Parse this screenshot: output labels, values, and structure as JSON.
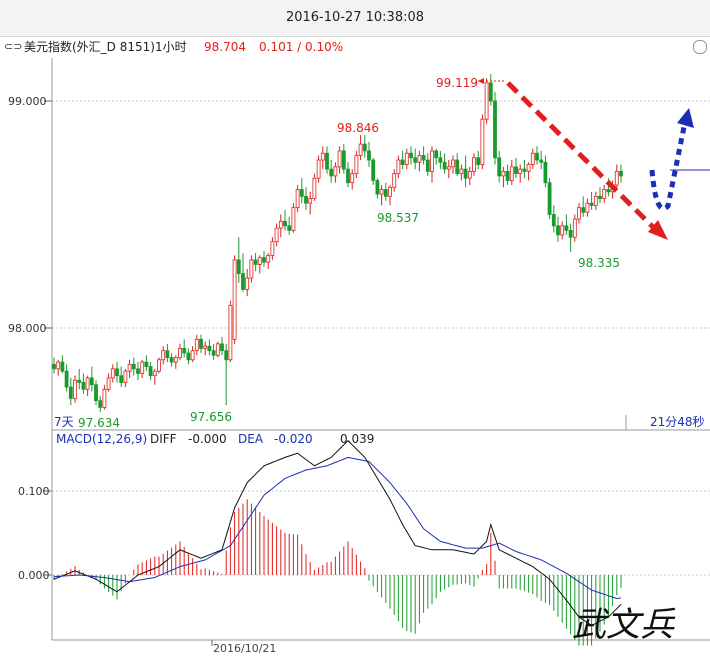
{
  "window": {
    "timestamp": "2016-10-27 10:38:08"
  },
  "instrument": {
    "link_icon": "⊂⊃",
    "name": "美元指数(外汇_D 8151)1小时",
    "price": "98.704",
    "change": "0.101 / 0.10%"
  },
  "colors": {
    "up": "#e0201c",
    "down": "#1a9a2e",
    "diff_line": "#111111",
    "dea_line": "#1b2fb5",
    "grid": "#c8c8c8",
    "trend_arrow": "#e0201c",
    "forecast_arrow": "#1b2fb5"
  },
  "chart_data": [
    {
      "type": "candlestick",
      "interval": "1小时",
      "y_tick_labels": [
        "99.000",
        "98.000"
      ],
      "ylim": [
        97.56,
        99.25
      ],
      "period_label": "7天",
      "countdown": "21分48秒",
      "annotations": [
        {
          "label": "99.119",
          "value": 99.119,
          "kind": "high"
        },
        {
          "label": "98.846",
          "value": 98.846,
          "kind": "high"
        },
        {
          "label": "98.537",
          "value": 98.537,
          "kind": "low"
        },
        {
          "label": "98.335",
          "value": 98.335,
          "kind": "low"
        },
        {
          "label": "97.634",
          "value": 97.634,
          "kind": "low"
        },
        {
          "label": "97.656",
          "value": 97.656,
          "kind": "low"
        }
      ],
      "ohlc": [
        [
          97.84,
          97.87,
          97.8,
          97.82
        ],
        [
          97.82,
          97.86,
          97.79,
          97.85
        ],
        [
          97.85,
          97.88,
          97.8,
          97.81
        ],
        [
          97.81,
          97.84,
          97.72,
          97.74
        ],
        [
          97.74,
          97.78,
          97.66,
          97.69
        ],
        [
          97.69,
          97.79,
          97.67,
          97.77
        ],
        [
          97.77,
          97.82,
          97.73,
          97.76
        ],
        [
          97.76,
          97.8,
          97.71,
          97.73
        ],
        [
          97.73,
          97.79,
          97.7,
          97.78
        ],
        [
          97.78,
          97.83,
          97.72,
          97.75
        ],
        [
          97.75,
          97.77,
          97.66,
          97.68
        ],
        [
          97.68,
          97.7,
          97.63,
          97.65
        ],
        [
          97.65,
          97.75,
          97.64,
          97.73
        ],
        [
          97.73,
          97.8,
          97.72,
          97.78
        ],
        [
          97.78,
          97.84,
          97.76,
          97.82
        ],
        [
          97.82,
          97.85,
          97.76,
          97.79
        ],
        [
          97.79,
          97.83,
          97.74,
          97.76
        ],
        [
          97.76,
          97.82,
          97.74,
          97.81
        ],
        [
          97.81,
          97.86,
          97.78,
          97.84
        ],
        [
          97.84,
          97.87,
          97.79,
          97.82
        ],
        [
          97.82,
          97.85,
          97.77,
          97.8
        ],
        [
          97.8,
          97.86,
          97.78,
          97.85
        ],
        [
          97.85,
          97.88,
          97.81,
          97.83
        ],
        [
          97.83,
          97.85,
          97.77,
          97.79
        ],
        [
          97.79,
          97.82,
          97.75,
          97.81
        ],
        [
          97.81,
          97.87,
          97.8,
          97.86
        ],
        [
          97.86,
          97.92,
          97.84,
          97.9
        ],
        [
          97.9,
          97.93,
          97.85,
          97.87
        ],
        [
          97.87,
          97.89,
          97.83,
          97.85
        ],
        [
          97.85,
          97.88,
          97.82,
          97.87
        ],
        [
          97.87,
          97.93,
          97.86,
          97.91
        ],
        [
          97.91,
          97.95,
          97.87,
          97.89
        ],
        [
          97.89,
          97.91,
          97.84,
          97.86
        ],
        [
          97.86,
          97.92,
          97.85,
          97.9
        ],
        [
          97.9,
          97.97,
          97.88,
          97.95
        ],
        [
          97.95,
          97.97,
          97.89,
          97.91
        ],
        [
          97.91,
          97.94,
          97.88,
          97.92
        ],
        [
          97.92,
          97.95,
          97.88,
          97.9
        ],
        [
          97.9,
          97.93,
          97.86,
          97.88
        ],
        [
          97.88,
          97.94,
          97.87,
          97.93
        ],
        [
          97.93,
          97.96,
          97.88,
          97.9
        ],
        [
          97.9,
          97.93,
          97.66,
          97.86
        ],
        [
          97.86,
          98.12,
          97.85,
          98.1
        ],
        [
          97.95,
          98.32,
          97.93,
          98.3
        ],
        [
          98.3,
          98.4,
          98.2,
          98.24
        ],
        [
          98.24,
          98.33,
          98.16,
          98.17
        ],
        [
          98.17,
          98.26,
          98.14,
          98.22
        ],
        [
          98.22,
          98.32,
          98.2,
          98.3
        ],
        [
          98.3,
          98.33,
          98.25,
          98.28
        ],
        [
          98.28,
          98.32,
          98.24,
          98.31
        ],
        [
          98.31,
          98.34,
          98.27,
          98.29
        ],
        [
          98.29,
          98.33,
          98.26,
          98.32
        ],
        [
          98.32,
          98.4,
          98.3,
          98.38
        ],
        [
          98.38,
          98.46,
          98.36,
          98.44
        ],
        [
          98.44,
          98.5,
          98.4,
          98.47
        ],
        [
          98.47,
          98.52,
          98.43,
          98.45
        ],
        [
          98.45,
          98.49,
          98.41,
          98.43
        ],
        [
          98.43,
          98.55,
          98.42,
          98.53
        ],
        [
          98.53,
          98.63,
          98.51,
          98.61
        ],
        [
          98.61,
          98.66,
          98.55,
          98.58
        ],
        [
          98.58,
          98.62,
          98.52,
          98.55
        ],
        [
          98.55,
          98.6,
          98.5,
          98.57
        ],
        [
          98.57,
          98.68,
          98.56,
          98.66
        ],
        [
          98.66,
          98.76,
          98.64,
          98.74
        ],
        [
          98.74,
          98.8,
          98.7,
          98.77
        ],
        [
          98.77,
          98.8,
          98.68,
          98.7
        ],
        [
          98.7,
          98.74,
          98.64,
          98.67
        ],
        [
          98.67,
          98.73,
          98.64,
          98.71
        ],
        [
          98.71,
          98.8,
          98.68,
          98.78
        ],
        [
          98.78,
          98.81,
          98.68,
          98.7
        ],
        [
          98.7,
          98.73,
          98.62,
          98.64
        ],
        [
          98.64,
          98.7,
          98.61,
          98.68
        ],
        [
          98.68,
          98.78,
          98.66,
          98.76
        ],
        [
          98.76,
          98.85,
          98.74,
          98.81
        ],
        [
          98.81,
          98.85,
          98.75,
          98.78
        ],
        [
          98.78,
          98.82,
          98.71,
          98.74
        ],
        [
          98.74,
          98.75,
          98.63,
          98.65
        ],
        [
          98.65,
          98.66,
          98.57,
          98.59
        ],
        [
          98.59,
          98.63,
          98.54,
          98.61
        ],
        [
          98.61,
          98.64,
          98.56,
          98.58
        ],
        [
          98.58,
          98.63,
          98.54,
          98.62
        ],
        [
          98.62,
          98.7,
          98.6,
          98.68
        ],
        [
          98.68,
          98.76,
          98.66,
          98.74
        ],
        [
          98.74,
          98.78,
          98.7,
          98.72
        ],
        [
          98.72,
          98.79,
          98.7,
          98.77
        ],
        [
          98.77,
          98.8,
          98.72,
          98.75
        ],
        [
          98.75,
          98.79,
          98.7,
          98.73
        ],
        [
          98.73,
          98.78,
          98.69,
          98.76
        ],
        [
          98.76,
          98.8,
          98.72,
          98.74
        ],
        [
          98.74,
          98.77,
          98.67,
          98.69
        ],
        [
          98.69,
          98.8,
          98.64,
          98.78
        ],
        [
          98.78,
          98.79,
          98.72,
          98.75
        ],
        [
          98.75,
          98.78,
          98.7,
          98.73
        ],
        [
          98.73,
          98.77,
          98.68,
          98.7
        ],
        [
          98.7,
          98.74,
          98.66,
          98.71
        ],
        [
          98.71,
          98.76,
          98.68,
          98.74
        ],
        [
          98.74,
          98.77,
          98.67,
          98.68
        ],
        [
          98.68,
          98.72,
          98.65,
          98.7
        ],
        [
          98.7,
          98.76,
          98.62,
          98.66
        ],
        [
          98.66,
          98.71,
          98.63,
          98.69
        ],
        [
          98.69,
          98.77,
          98.67,
          98.75
        ],
        [
          98.75,
          98.78,
          98.7,
          98.72
        ],
        [
          98.72,
          98.94,
          98.7,
          98.92
        ],
        [
          98.92,
          99.1,
          98.9,
          99.08
        ],
        [
          99.08,
          99.119,
          98.98,
          99.0
        ],
        [
          99.0,
          99.04,
          98.72,
          98.75
        ],
        [
          98.75,
          98.78,
          98.64,
          98.67
        ],
        [
          98.67,
          98.71,
          98.62,
          98.69
        ],
        [
          98.69,
          98.72,
          98.63,
          98.65
        ],
        [
          98.65,
          98.74,
          98.63,
          98.71
        ],
        [
          98.71,
          98.75,
          98.66,
          98.68
        ],
        [
          98.68,
          98.72,
          98.64,
          98.7
        ],
        [
          98.7,
          98.74,
          98.66,
          98.69
        ],
        [
          98.69,
          98.73,
          98.65,
          98.72
        ],
        [
          98.72,
          98.79,
          98.7,
          98.77
        ],
        [
          98.77,
          98.8,
          98.72,
          98.74
        ],
        [
          98.74,
          98.78,
          98.7,
          98.73
        ],
        [
          98.73,
          98.76,
          98.62,
          98.64
        ],
        [
          98.64,
          98.66,
          98.48,
          98.5
        ],
        [
          98.5,
          98.54,
          98.42,
          98.45
        ],
        [
          98.45,
          98.49,
          98.38,
          98.41
        ],
        [
          98.41,
          98.47,
          98.39,
          98.45
        ],
        [
          98.45,
          98.5,
          98.41,
          98.43
        ],
        [
          98.43,
          98.46,
          98.335,
          98.4
        ],
        [
          98.4,
          98.5,
          98.38,
          98.48
        ],
        [
          98.48,
          98.55,
          98.46,
          98.53
        ],
        [
          98.53,
          98.58,
          98.49,
          98.51
        ],
        [
          98.51,
          98.57,
          98.49,
          98.55
        ],
        [
          98.55,
          98.6,
          98.52,
          98.54
        ],
        [
          98.54,
          98.6,
          98.52,
          98.58
        ],
        [
          98.58,
          98.62,
          98.55,
          98.57
        ],
        [
          98.57,
          98.63,
          98.55,
          98.61
        ],
        [
          98.61,
          98.66,
          98.58,
          98.6
        ],
        [
          98.6,
          98.65,
          98.57,
          98.63
        ],
        [
          98.63,
          98.72,
          98.61,
          98.69
        ],
        [
          98.69,
          98.72,
          98.64,
          98.67
        ]
      ]
    },
    {
      "type": "macd",
      "params": "MACD(12,26,9)",
      "diff_label": "DIFF",
      "diff_value": "-0.000",
      "dea_label": "DEA",
      "dea_value": "-0.020",
      "macd_value": "0.039",
      "y_tick_labels": [
        "0.100",
        "0.000"
      ],
      "ylim": [
        -0.085,
        0.18
      ],
      "x_tick_label": "2016/10/21",
      "diff_keypoints": [
        [
          0,
          -0.005
        ],
        [
          5,
          0.005
        ],
        [
          10,
          -0.005
        ],
        [
          15,
          -0.02
        ],
        [
          20,
          0.0
        ],
        [
          25,
          0.01
        ],
        [
          30,
          0.03
        ],
        [
          35,
          0.02
        ],
        [
          40,
          0.03
        ],
        [
          43,
          0.08
        ],
        [
          46,
          0.11
        ],
        [
          50,
          0.13
        ],
        [
          55,
          0.14
        ],
        [
          58,
          0.145
        ],
        [
          62,
          0.13
        ],
        [
          66,
          0.14
        ],
        [
          70,
          0.16
        ],
        [
          74,
          0.14
        ],
        [
          77,
          0.115
        ],
        [
          80,
          0.09
        ],
        [
          83,
          0.06
        ],
        [
          86,
          0.035
        ],
        [
          90,
          0.03
        ],
        [
          95,
          0.03
        ],
        [
          100,
          0.025
        ],
        [
          103,
          0.04
        ],
        [
          104,
          0.06
        ],
        [
          106,
          0.03
        ],
        [
          110,
          0.02
        ],
        [
          114,
          0.01
        ],
        [
          118,
          -0.005
        ],
        [
          122,
          -0.03
        ],
        [
          125,
          -0.05
        ],
        [
          128,
          -0.06
        ],
        [
          132,
          -0.05
        ],
        [
          136,
          -0.03
        ],
        [
          140,
          -0.015
        ],
        [
          143,
          0.0
        ]
      ],
      "dea_keypoints": [
        [
          0,
          -0.002
        ],
        [
          6,
          0.0
        ],
        [
          12,
          -0.003
        ],
        [
          18,
          -0.008
        ],
        [
          24,
          -0.003
        ],
        [
          30,
          0.01
        ],
        [
          36,
          0.018
        ],
        [
          42,
          0.035
        ],
        [
          46,
          0.065
        ],
        [
          50,
          0.095
        ],
        [
          55,
          0.115
        ],
        [
          60,
          0.125
        ],
        [
          65,
          0.13
        ],
        [
          70,
          0.14
        ],
        [
          75,
          0.135
        ],
        [
          80,
          0.11
        ],
        [
          84,
          0.085
        ],
        [
          88,
          0.055
        ],
        [
          92,
          0.04
        ],
        [
          98,
          0.032
        ],
        [
          102,
          0.032
        ],
        [
          106,
          0.038
        ],
        [
          110,
          0.028
        ],
        [
          116,
          0.018
        ],
        [
          122,
          0.002
        ],
        [
          128,
          -0.018
        ],
        [
          134,
          -0.028
        ],
        [
          139,
          -0.025
        ],
        [
          143,
          -0.02
        ]
      ]
    }
  ],
  "watermark_text": "武文兵"
}
